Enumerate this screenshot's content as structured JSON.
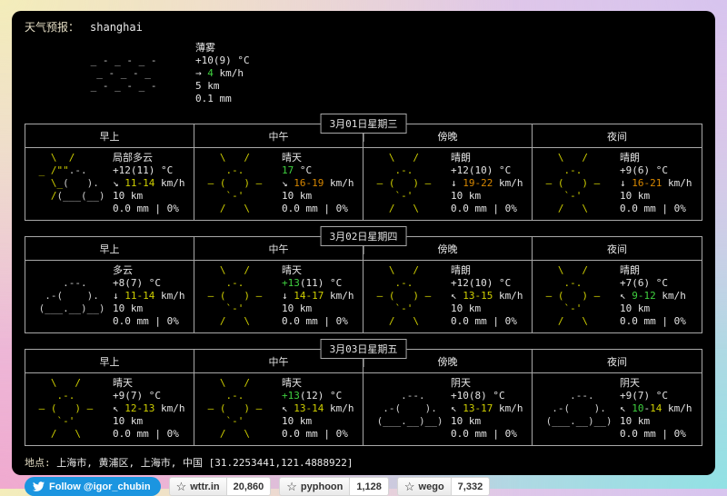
{
  "title": {
    "label": "天气预报：",
    "location": "shanghai"
  },
  "current": {
    "condition": "薄雾",
    "art_sun": "",
    "art_cloud": "\n _ - _ - _ -\n  _ - _ - _\n _ - _ - _ -",
    "temp": [
      [
        "+10(9)",
        "fg"
      ],
      [
        " °C",
        "fg"
      ]
    ],
    "wind": [
      [
        "→ ",
        "fg"
      ],
      [
        "4",
        "green"
      ],
      [
        " km/h",
        "fg"
      ]
    ],
    "visibility": "5 km",
    "precip": "0.1 mm"
  },
  "period_headers": [
    "早上",
    "中午",
    "傍晚",
    "夜间"
  ],
  "days": [
    {
      "date": "3月01日星期三",
      "cells": [
        {
          "condition": "局部多云",
          "art_sun": "   \\  /\n _ /\"\"\n   \\_\n   /",
          "art_cloud": "\n      .-.\n     (   ).\n    (___(__)",
          "temp": [
            [
              "+12(11)",
              "fg"
            ],
            [
              " °C",
              "fg"
            ]
          ],
          "wind": [
            [
              "↘ ",
              "fg"
            ],
            [
              "11-14",
              "yellow"
            ],
            [
              " km/h",
              "fg"
            ]
          ],
          "visibility": "10 km",
          "precip": "0.0 mm | 0%"
        },
        {
          "condition": "晴天",
          "art_sun": "   \\   /\n    .-.\n ‒ (   ) ‒\n    `-'\n   /   \\",
          "art_cloud": "",
          "temp": [
            [
              "17",
              "green"
            ],
            [
              " °C",
              "fg"
            ]
          ],
          "wind": [
            [
              "↘ ",
              "fg"
            ],
            [
              "16-19",
              "orange"
            ],
            [
              " km/h",
              "fg"
            ]
          ],
          "visibility": "10 km",
          "precip": "0.0 mm | 0%"
        },
        {
          "condition": "晴朗",
          "art_sun": "   \\   /\n    .-.\n ‒ (   ) ‒\n    `-'\n   /   \\",
          "art_cloud": "",
          "temp": [
            [
              "+12(10)",
              "fg"
            ],
            [
              " °C",
              "fg"
            ]
          ],
          "wind": [
            [
              "↓ ",
              "fg"
            ],
            [
              "19-22",
              "orange"
            ],
            [
              " km/h",
              "fg"
            ]
          ],
          "visibility": "10 km",
          "precip": "0.0 mm | 0%"
        },
        {
          "condition": "晴朗",
          "art_sun": "   \\   /\n    .-.\n ‒ (   ) ‒\n    `-'\n   /   \\",
          "art_cloud": "",
          "temp": [
            [
              "+9(6)",
              "fg"
            ],
            [
              " °C",
              "fg"
            ]
          ],
          "wind": [
            [
              "↓ ",
              "fg"
            ],
            [
              "16-21",
              "orange"
            ],
            [
              " km/h",
              "fg"
            ]
          ],
          "visibility": "10 km",
          "precip": "0.0 mm | 0%"
        }
      ]
    },
    {
      "date": "3月02日星期四",
      "cells": [
        {
          "condition": "多云",
          "art_sun": "",
          "art_cloud": "\n     .--.\n  .-(    ).\n (___.__)__)",
          "temp": [
            [
              "+8(7)",
              "fg"
            ],
            [
              " °C",
              "fg"
            ]
          ],
          "wind": [
            [
              "↓ ",
              "fg"
            ],
            [
              "11-14",
              "yellow"
            ],
            [
              " km/h",
              "fg"
            ]
          ],
          "visibility": "10 km",
          "precip": "0.0 mm | 0%"
        },
        {
          "condition": "晴天",
          "art_sun": "   \\   /\n    .-.\n ‒ (   ) ‒\n    `-'\n   /   \\",
          "art_cloud": "",
          "temp": [
            [
              "+13",
              "green"
            ],
            [
              "(11) °C",
              "fg"
            ]
          ],
          "wind": [
            [
              "↓ ",
              "fg"
            ],
            [
              "14-17",
              "yellow"
            ],
            [
              " km/h",
              "fg"
            ]
          ],
          "visibility": "10 km",
          "precip": "0.0 mm | 0%"
        },
        {
          "condition": "晴朗",
          "art_sun": "   \\   /\n    .-.\n ‒ (   ) ‒\n    `-'\n   /   \\",
          "art_cloud": "",
          "temp": [
            [
              "+12(10)",
              "fg"
            ],
            [
              " °C",
              "fg"
            ]
          ],
          "wind": [
            [
              "↖ ",
              "fg"
            ],
            [
              "13-15",
              "yellow"
            ],
            [
              " km/h",
              "fg"
            ]
          ],
          "visibility": "10 km",
          "precip": "0.0 mm | 0%"
        },
        {
          "condition": "晴朗",
          "art_sun": "   \\   /\n    .-.\n ‒ (   ) ‒\n    `-'\n   /   \\",
          "art_cloud": "",
          "temp": [
            [
              "+7(6)",
              "fg"
            ],
            [
              " °C",
              "fg"
            ]
          ],
          "wind": [
            [
              "↖ ",
              "fg"
            ],
            [
              "9-12",
              "green"
            ],
            [
              " km/h",
              "fg"
            ]
          ],
          "visibility": "10 km",
          "precip": "0.0 mm | 0%"
        }
      ]
    },
    {
      "date": "3月03日星期五",
      "cells": [
        {
          "condition": "晴天",
          "art_sun": "   \\   /\n    .-.\n ‒ (   ) ‒\n    `-'\n   /   \\",
          "art_cloud": "",
          "temp": [
            [
              "+9(7)",
              "fg"
            ],
            [
              " °C",
              "fg"
            ]
          ],
          "wind": [
            [
              "↖ ",
              "fg"
            ],
            [
              "12-13",
              "yellow"
            ],
            [
              " km/h",
              "fg"
            ]
          ],
          "visibility": "10 km",
          "precip": "0.0 mm | 0%"
        },
        {
          "condition": "晴天",
          "art_sun": "   \\   /\n    .-.\n ‒ (   ) ‒\n    `-'\n   /   \\",
          "art_cloud": "",
          "temp": [
            [
              "+13",
              "green"
            ],
            [
              "(12) °C",
              "fg"
            ]
          ],
          "wind": [
            [
              "↖ ",
              "fg"
            ],
            [
              "13-14",
              "yellow"
            ],
            [
              " km/h",
              "fg"
            ]
          ],
          "visibility": "10 km",
          "precip": "0.0 mm | 0%"
        },
        {
          "condition": "阴天",
          "art_sun": "",
          "art_cloud": "\n     .--.\n  .-(    ).\n (___.__)__)",
          "temp": [
            [
              "+10(8)",
              "fg"
            ],
            [
              " °C",
              "fg"
            ]
          ],
          "wind": [
            [
              "↖ ",
              "fg"
            ],
            [
              "13-17",
              "yellow"
            ],
            [
              " km/h",
              "fg"
            ]
          ],
          "visibility": "10 km",
          "precip": "0.0 mm | 0%"
        },
        {
          "condition": "阴天",
          "art_sun": "",
          "art_cloud": "\n     .--.\n  .-(    ).\n (___.__)__)",
          "temp": [
            [
              "+9(7)",
              "fg"
            ],
            [
              " °C",
              "fg"
            ]
          ],
          "wind": [
            [
              "↖ ",
              "fg"
            ],
            [
              "10",
              "green"
            ],
            [
              "-",
              "fg"
            ],
            [
              "14",
              "yellow"
            ],
            [
              " km/h",
              "fg"
            ]
          ],
          "visibility": "10 km",
          "precip": "0.0 mm | 0%"
        }
      ]
    }
  ],
  "location_line": {
    "label": "地点:",
    "text": " 上海市, 黄浦区, 上海市, 中国 [31.2253441,121.4888922]"
  },
  "badges": {
    "twitter": {
      "label": "Follow @igor_chubin"
    },
    "github": [
      {
        "name": "wttr.in",
        "count": "20,860"
      },
      {
        "name": "pyphoon",
        "count": "1,128"
      },
      {
        "name": "wego",
        "count": "7,332"
      }
    ]
  },
  "colors": {
    "accent_yellow": "#cfcf00",
    "accent_orange": "#d78700",
    "accent_green": "#3fd03f",
    "twitter_blue": "#1b95e0",
    "terminal_bg": "#000000"
  }
}
